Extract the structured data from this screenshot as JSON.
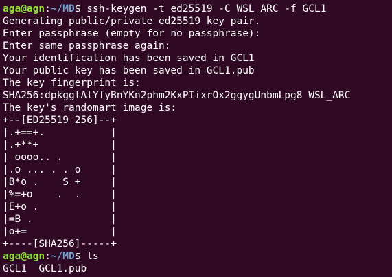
{
  "prompt": {
    "user_host": "aga@agn",
    "separator": ":",
    "path": "~/MD",
    "symbol": "$ "
  },
  "commands": {
    "keygen": "ssh-keygen -t ed25519 -C WSL_ARC -f GCL1",
    "ls": "ls"
  },
  "output": {
    "keygen_lines": [
      "Generating public/private ed25519 key pair.",
      "Enter passphrase (empty for no passphrase):",
      "Enter same passphrase again:",
      "Your identification has been saved in GCL1",
      "Your public key has been saved in GCL1.pub",
      "The key fingerprint is:",
      "SHA256:dpkggtAlYfyBnYKn2phm2KxPIixrOx2ggygUnbmLpg8 WSL_ARC",
      "The key's randomart image is:"
    ],
    "randomart": [
      "+--[ED25519 256]--+",
      "|.+==+.           |",
      "|.+**+            |",
      "| oooo.. .        |",
      "|.o ... . . o     |",
      "|B*o .    S +     |",
      "|%=+o    .  .     |",
      "|E+o .            |",
      "|=B .             |",
      "|o+=              |",
      "+----[SHA256]-----+"
    ],
    "ls_result": "GCL1  GCL1.pub"
  }
}
